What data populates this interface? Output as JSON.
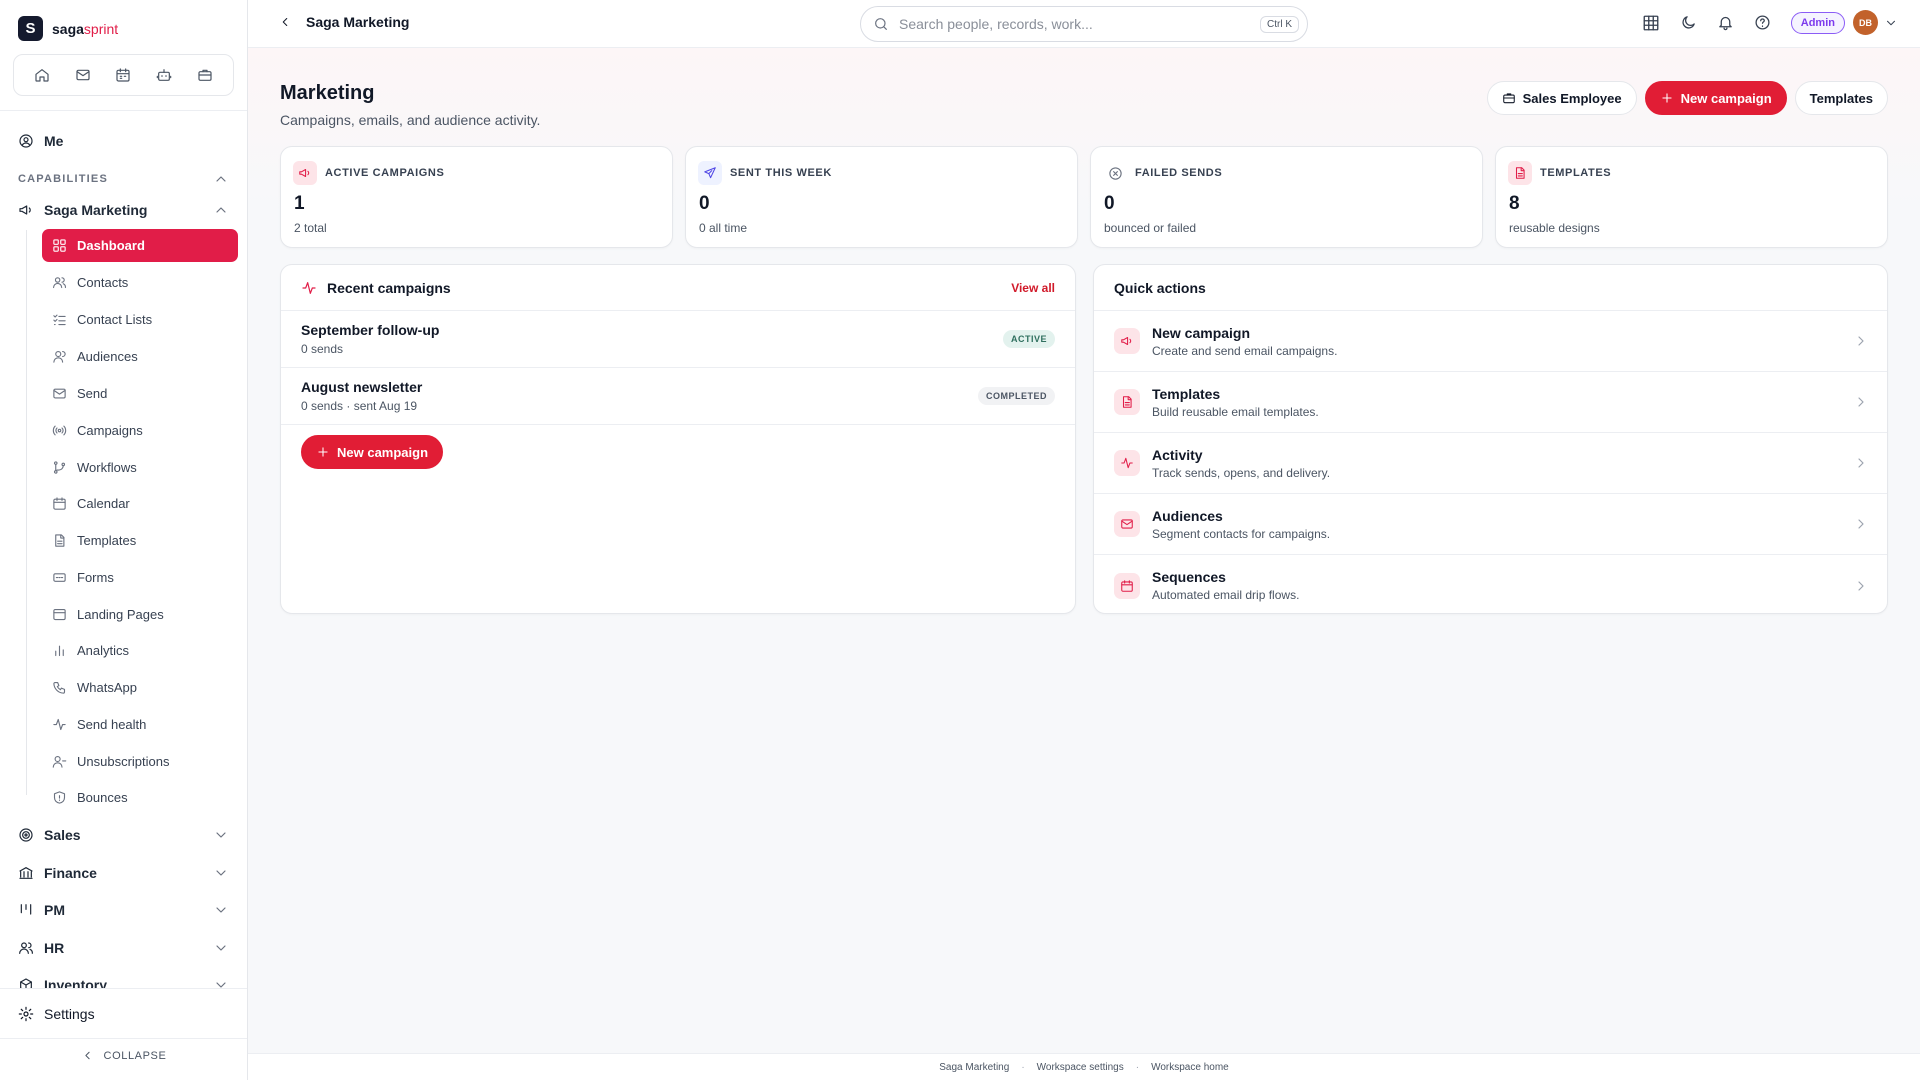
{
  "brand": {
    "prefix": "saga",
    "accent": "sprint",
    "logo_letter": "S"
  },
  "sidebar": {
    "me_label": "Me",
    "capabilities_label": "CAPABILITIES",
    "module_label": "Saga Marketing",
    "items": [
      {
        "label": "Dashboard",
        "icon": "dashboard-icon",
        "active": true
      },
      {
        "label": "Contacts",
        "icon": "contacts-icon"
      },
      {
        "label": "Contact Lists",
        "icon": "list-check-icon"
      },
      {
        "label": "Audiences",
        "icon": "audiences-icon"
      },
      {
        "label": "Send",
        "icon": "mail-icon"
      },
      {
        "label": "Campaigns",
        "icon": "broadcast-icon"
      },
      {
        "label": "Workflows",
        "icon": "workflow-icon"
      },
      {
        "label": "Calendar",
        "icon": "calendar-icon"
      },
      {
        "label": "Templates",
        "icon": "document-icon"
      },
      {
        "label": "Forms",
        "icon": "form-icon"
      },
      {
        "label": "Landing Pages",
        "icon": "layout-icon"
      },
      {
        "label": "Analytics",
        "icon": "bar-chart-icon"
      },
      {
        "label": "WhatsApp",
        "icon": "phone-icon"
      },
      {
        "label": "Send health",
        "icon": "activity-icon"
      },
      {
        "label": "Unsubscriptions",
        "icon": "user-minus-icon"
      },
      {
        "label": "Bounces",
        "icon": "shield-icon"
      }
    ],
    "groups": [
      {
        "label": "Sales",
        "icon": "target-icon"
      },
      {
        "label": "Finance",
        "icon": "bank-icon"
      },
      {
        "label": "PM",
        "icon": "kanban-icon"
      },
      {
        "label": "HR",
        "icon": "users-icon"
      },
      {
        "label": "Inventory",
        "icon": "box-icon"
      }
    ],
    "settings_label": "Settings",
    "collapse_label": "COLLAPSE"
  },
  "topbar": {
    "breadcrumb": "Saga Marketing",
    "search_placeholder": "Search people, records, work...",
    "search_shortcut": "Ctrl K",
    "role_badge": "Admin",
    "avatar_initials": "DB"
  },
  "page": {
    "title": "Marketing",
    "subtitle": "Campaigns, emails, and audience activity.",
    "actions": {
      "sales_employee": "Sales Employee",
      "new_campaign": "New campaign",
      "templates": "Templates"
    }
  },
  "stats": [
    {
      "label": "ACTIVE CAMPAIGNS",
      "value": "1",
      "desc": "2 total",
      "icon": "megaphone-icon"
    },
    {
      "label": "SENT THIS WEEK",
      "value": "0",
      "desc": "0 all time",
      "icon": "send-icon"
    },
    {
      "label": "FAILED SENDS",
      "value": "0",
      "desc": "bounced or failed",
      "icon": "x-circle-icon"
    },
    {
      "label": "TEMPLATES",
      "value": "8",
      "desc": "reusable designs",
      "icon": "document-icon"
    }
  ],
  "recent": {
    "title": "Recent campaigns",
    "view_all": "View all",
    "rows": [
      {
        "name": "September follow-up",
        "meta": "0 sends",
        "status": "ACTIVE"
      },
      {
        "name": "August newsletter",
        "meta": "0 sends · sent Aug 19",
        "status": "COMPLETED"
      }
    ],
    "new_button": "New campaign"
  },
  "quick": {
    "title": "Quick actions",
    "rows": [
      {
        "title": "New campaign",
        "desc": "Create and send email campaigns.",
        "icon": "megaphone-icon"
      },
      {
        "title": "Templates",
        "desc": "Build reusable email templates.",
        "icon": "document-icon"
      },
      {
        "title": "Activity",
        "desc": "Track sends, opens, and delivery.",
        "icon": "activity-icon"
      },
      {
        "title": "Audiences",
        "desc": "Segment contacts for campaigns.",
        "icon": "mail-icon"
      },
      {
        "title": "Sequences",
        "desc": "Automated email drip flows.",
        "icon": "calendar-icon"
      }
    ]
  },
  "footer": {
    "links": [
      "Saga Marketing",
      "Workspace settings",
      "Workspace home"
    ]
  },
  "colors": {
    "accent": "#e11d48",
    "primary_button": "#e11d35",
    "admin_badge": "#7c3aed",
    "avatar": "#c2622b"
  }
}
